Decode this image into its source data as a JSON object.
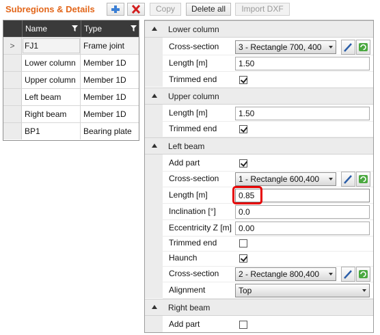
{
  "toolbar": {
    "title": "Subregions & Details",
    "add_icon": "plus-icon",
    "delete_icon": "red-x-icon",
    "copy_label": "Copy",
    "delete_all_label": "Delete all",
    "import_dxf_label": "Import DXF"
  },
  "list": {
    "columns": [
      "Name",
      "Type"
    ],
    "current_marker": ">",
    "rows": [
      {
        "name": "FJ1",
        "type": "Frame joint"
      },
      {
        "name": "Lower column",
        "type": "Member 1D"
      },
      {
        "name": "Upper column",
        "type": "Member 1D"
      },
      {
        "name": "Left beam",
        "type": "Member 1D"
      },
      {
        "name": "Right beam",
        "type": "Member 1D"
      },
      {
        "name": "BP1",
        "type": "Bearing plate"
      }
    ]
  },
  "properties": {
    "lower_column": {
      "header": "Lower column",
      "cross_section_label": "Cross-section",
      "cross_section_value": "3 - Rectangle 700, 400",
      "length_label": "Length [m]",
      "length_value": "1.50",
      "trimmed_end_label": "Trimmed end",
      "trimmed_end_checked": true
    },
    "upper_column": {
      "header": "Upper column",
      "length_label": "Length [m]",
      "length_value": "1.50",
      "trimmed_end_label": "Trimmed end",
      "trimmed_end_checked": true
    },
    "left_beam": {
      "header": "Left beam",
      "add_part_label": "Add part",
      "add_part_checked": true,
      "cross_section_label": "Cross-section",
      "cross_section_value": "1 - Rectangle 600,400",
      "length_label": "Length [m]",
      "length_value": "0.85",
      "inclination_label": "Inclination [°]",
      "inclination_value": "0.0",
      "eccentricity_label": "Eccentricity Z [m]",
      "eccentricity_value": "0.00",
      "trimmed_end_label": "Trimmed end",
      "trimmed_end_checked": false,
      "haunch_label": "Haunch",
      "haunch_checked": true,
      "haunch_cross_section_label": "Cross-section",
      "haunch_cross_section_value": "2 - Rectangle 800,400",
      "alignment_label": "Alignment",
      "alignment_value": "Top"
    },
    "right_beam": {
      "header": "Right beam",
      "add_part_label": "Add part",
      "add_part_checked": false
    }
  },
  "colors": {
    "title": "#e2661a",
    "highlight": "#e60000",
    "list_header": "#3a3a3a",
    "section_bg": "#ececec"
  },
  "icons": {
    "edit": "pencil-icon",
    "refresh": "refresh-icon",
    "collapse": "collapse-triangle-icon",
    "filter": "filter-icon"
  }
}
